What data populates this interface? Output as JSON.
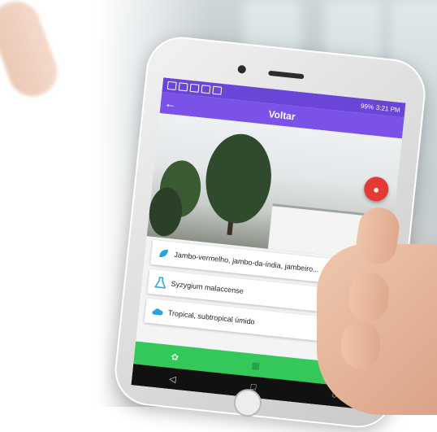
{
  "statusbar": {
    "battery": "99%",
    "time": "3:21 PM"
  },
  "appbar": {
    "title": "Voltar",
    "back_icon": "arrow-left-icon"
  },
  "photo": {
    "location_button_icon": "map-pin-icon"
  },
  "cards": [
    {
      "icon": "leaf-icon",
      "text": "Jambo-vermelho, jambo-da-índia, jambeiro..."
    },
    {
      "icon": "flask-icon",
      "text": "Syzygium malaccense"
    },
    {
      "icon": "cloud-icon",
      "text": "Tropical, subtropical úmido"
    }
  ],
  "bottom_nav": [
    {
      "icon": "leaf-icon"
    },
    {
      "icon": "map-icon"
    },
    {
      "icon": "search-icon"
    }
  ],
  "fab": {
    "icon": "expand-icon"
  },
  "system_nav": [
    {
      "icon": "back-triangle-icon"
    },
    {
      "icon": "home-circle-icon"
    },
    {
      "icon": "recents-square-icon"
    }
  ],
  "colors": {
    "statusbar": "#6a45d8",
    "appbar": "#7b52e8",
    "bottom_nav": "#34c759",
    "location_button": "#e53935",
    "fab": "#2f7ef0",
    "card_icon": "#29a3e0"
  }
}
